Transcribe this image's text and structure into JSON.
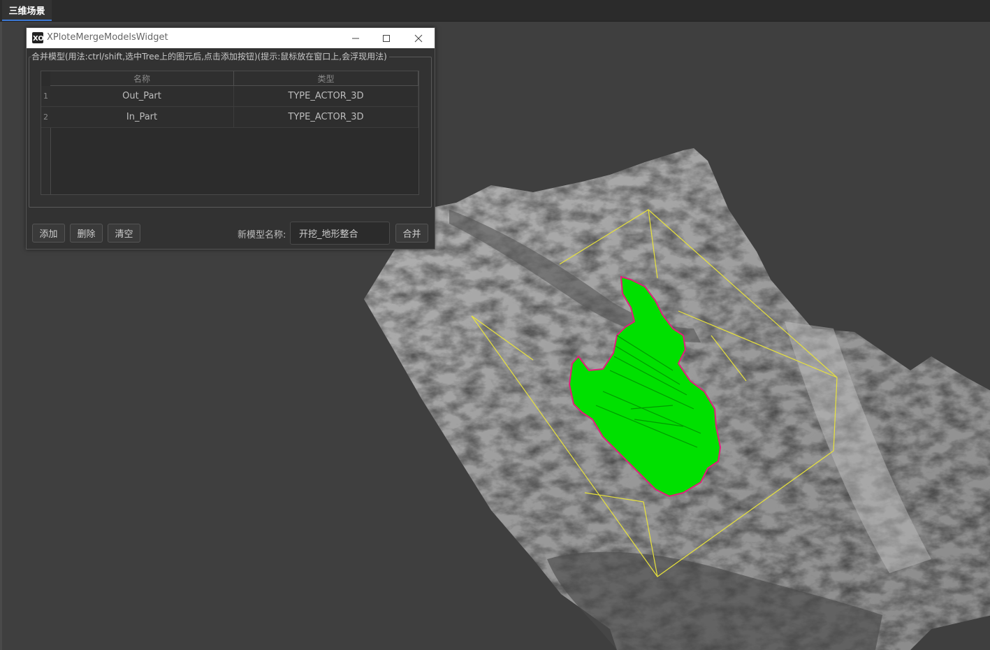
{
  "tabs": [
    {
      "label": "三维场景",
      "active": true
    }
  ],
  "dialog": {
    "title": "XPloteMergeModelsWidget",
    "hint": "合并模型(用法:ctrl/shift,选中Tree上的图元后,点击添加按钮)(提示:鼠标放在窗口上,会浮现用法)",
    "table": {
      "headers": [
        "名称",
        "类型"
      ],
      "rows": [
        {
          "index": "1",
          "name": "Out_Part",
          "type": "TYPE_ACTOR_3D"
        },
        {
          "index": "2",
          "name": "In_Part",
          "type": "TYPE_ACTOR_3D"
        }
      ]
    },
    "buttons": {
      "add": "添加",
      "delete": "删除",
      "clear": "清空",
      "merge": "合并"
    },
    "new_model_label": "新模型名称:",
    "new_model_value": "开挖_地形整合",
    "window_controls": [
      "minimize-icon",
      "maximize-icon",
      "close-icon"
    ]
  },
  "scene": {
    "terrain_color": "#a8a8a8",
    "excavation_color": "#00e000",
    "outline_color": "#e0207a",
    "bbox_color": "#e8e23a",
    "background_color": "#3f3f3f"
  }
}
